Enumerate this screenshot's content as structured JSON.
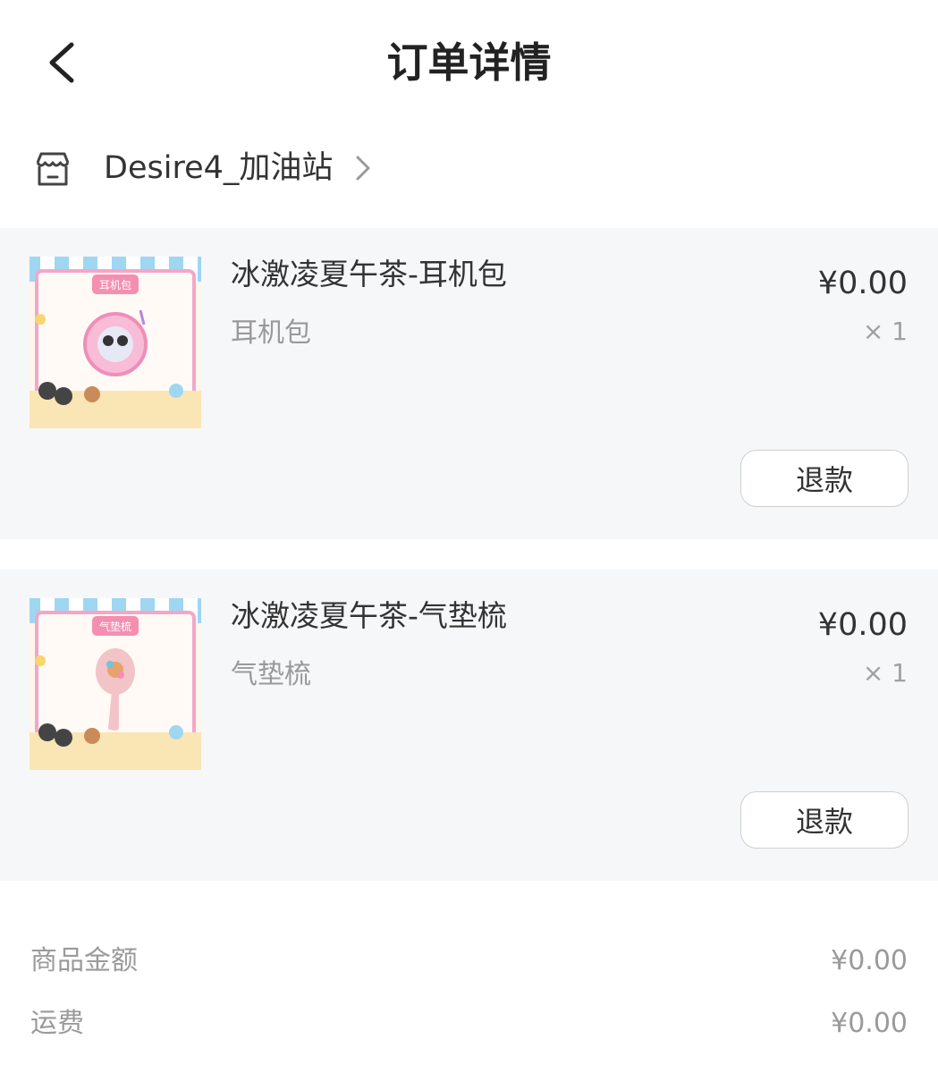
{
  "header": {
    "title": "订单详情"
  },
  "shop": {
    "name": "Desire4_加油站"
  },
  "items": [
    {
      "title": "冰激凌夏午茶-耳机包",
      "spec": "耳机包",
      "price": "¥0.00",
      "qty": "× 1",
      "refund_label": "退款",
      "thumb_label": "耳机包"
    },
    {
      "title": "冰激凌夏午茶-气垫梳",
      "spec": "气垫梳",
      "price": "¥0.00",
      "qty": "× 1",
      "refund_label": "退款",
      "thumb_label": "气垫梳"
    }
  ],
  "summary": [
    {
      "label": "商品金额",
      "value": "¥0.00"
    },
    {
      "label": "运费",
      "value": "¥0.00"
    }
  ],
  "colors": {
    "card_bg": "#f6f7f9",
    "thumb_pink": "#f4a6c8",
    "thumb_blue": "#9fd6f2",
    "thumb_sand": "#fae5b4"
  },
  "icons": [
    "back-arrow-icon",
    "shop-icon",
    "chevron-right-icon"
  ]
}
